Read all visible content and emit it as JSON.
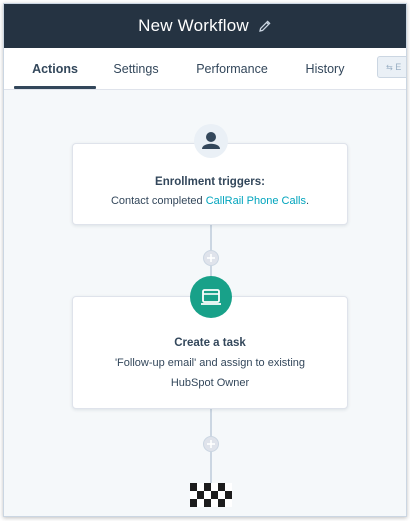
{
  "header": {
    "title": "New Workflow",
    "bg_color": "#253342"
  },
  "tabs": [
    {
      "label": "Actions",
      "active": true
    },
    {
      "label": "Settings",
      "active": false
    },
    {
      "label": "Performance",
      "active": false
    },
    {
      "label": "History",
      "active": false
    }
  ],
  "toolbar": {
    "export_label": "E"
  },
  "trigger_card": {
    "icon": "person-icon",
    "heading": "Enrollment triggers:",
    "text_prefix": "Contact completed ",
    "link_text": "CallRail Phone Calls",
    "text_suffix": "."
  },
  "action_card": {
    "icon": "task-icon",
    "icon_color": "#18a189",
    "heading": "Create a task",
    "line1": "'Follow-up email' and assign to existing",
    "line2": "HubSpot Owner"
  },
  "colors": {
    "link": "#00a4bd",
    "canvas": "#f5f8fa"
  }
}
